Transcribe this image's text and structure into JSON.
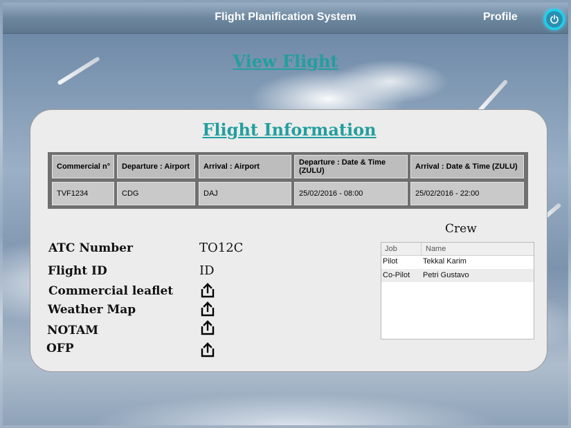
{
  "header": {
    "title": "Flight Planification System",
    "profile_label": "Profile"
  },
  "page": {
    "title": "View Flight",
    "section_title": "Flight Information"
  },
  "flight_table": {
    "headers": [
      "Commercial n°",
      "Departure : Airport",
      "Arrival : Airport",
      "Departure : Date & Time (ZULU)",
      "Arrival : Date & Time (ZULU)"
    ],
    "row": [
      "TVF1234",
      "CDG",
      "DAJ",
      "25/02/2016 - 08:00",
      "25/02/2016 - 22:00"
    ]
  },
  "details": {
    "atc_label": "ATC Number",
    "atc_value": "TO12C",
    "flight_id_label": "Flight ID",
    "flight_id_value": "ID",
    "leaflet_label": "Commercial leaflet",
    "weather_label": "Weather Map",
    "notam_label": "NOTAM",
    "ofp_label": "OFP"
  },
  "crew": {
    "title": "Crew",
    "headers": [
      "Job",
      "Name"
    ],
    "rows": [
      {
        "job": "Pilot",
        "name": "Tekkal Karim"
      },
      {
        "job": "Co-Pilot",
        "name": "Petri Gustavo"
      }
    ]
  },
  "colors": {
    "accent": "#239e9e",
    "power": "#19d3ee",
    "header": "#6d879f"
  },
  "icons": {
    "power": "power-icon",
    "share": "share-icon"
  }
}
